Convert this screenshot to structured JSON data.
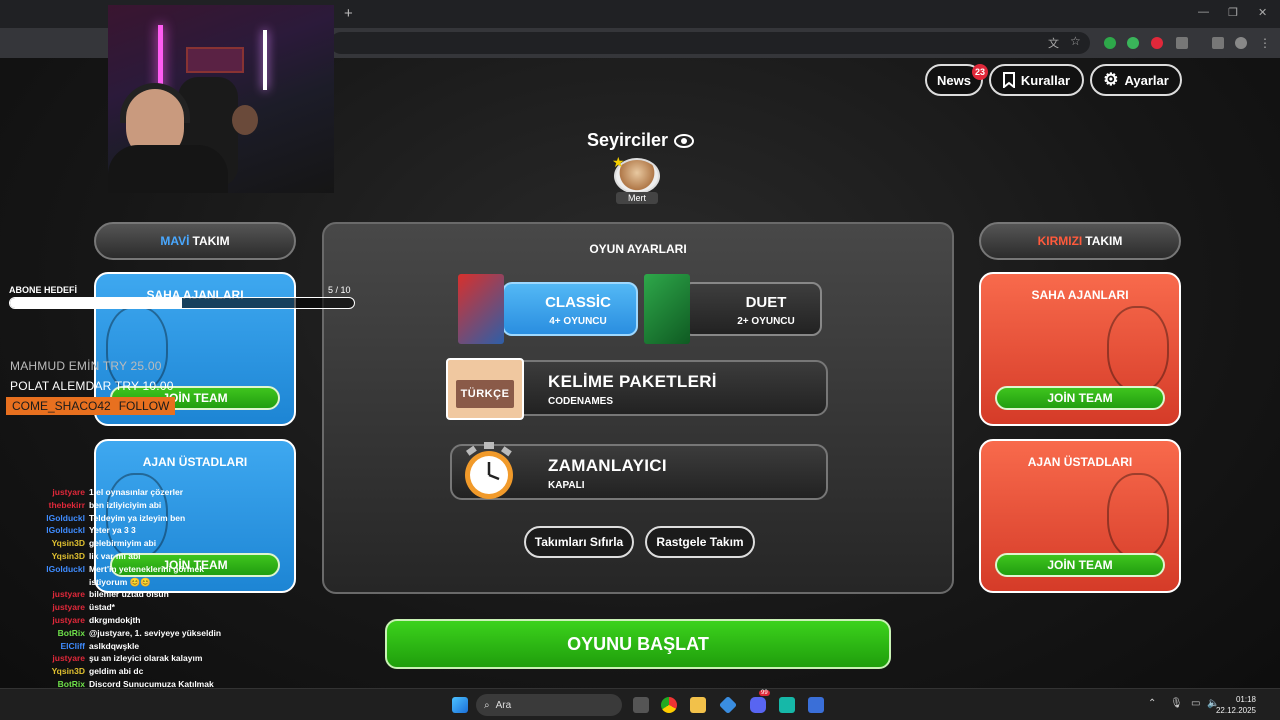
{
  "browser": {
    "new_tab_symbol": "+"
  },
  "header": {
    "news_label": "News",
    "news_badge": "23",
    "rules_label": "Kurallar",
    "settings_label": "Ayarlar"
  },
  "spectators": {
    "title": "Seyirciler",
    "user": "Mert"
  },
  "blue_team": {
    "title_color_word": "MAVİ",
    "title_word": "TAKIM",
    "operatives_title": "SAHA AJANLARI",
    "spymasters_title": "AJAN ÜSTADLARI",
    "join_label": "JOİN TEAM"
  },
  "red_team": {
    "title_color_word": "KIRMIZI",
    "title_word": "TAKIM",
    "operatives_title": "SAHA AJANLARI",
    "spymasters_title": "AJAN ÜSTADLARI",
    "join_label": "JOİN TEAM"
  },
  "game_settings": {
    "title": "OYUN AYARLARI",
    "modes": [
      {
        "name": "CLASSİC",
        "sub": "4+ OYUNCU",
        "selected": true
      },
      {
        "name": "DUET",
        "sub": "2+ OYUNCU",
        "selected": false
      }
    ],
    "word_packs": {
      "title": "KELİME PAKETLERİ",
      "sub": "CODENAMES",
      "tag": "TÜRKÇE"
    },
    "timer": {
      "title": "ZAMANLAYICI",
      "sub": "KAPALI"
    },
    "reset_teams_label": "Takımları Sıfırla",
    "random_team_label": "Rastgele Takım"
  },
  "start_label": "OYUNU BAŞLAT",
  "stream_overlay": {
    "goal_label": "ABONE HEDEFİ",
    "goal_count": "5 / 10",
    "goal_progress": 0.5,
    "donors": [
      "MAHMUD EMİN TRY 25.00",
      "POLAT ALEMDAR  TRY 10.00"
    ],
    "follow_name": "COME_SHACO42",
    "follow_label": "FOLLOW",
    "chat": [
      {
        "user": "justyare",
        "msg": "1 el oynasınlar çözerler",
        "color": "#e0283a"
      },
      {
        "user": "thebekirr",
        "msg": "ben izliyiciyim abi",
        "color": "#e0283a"
      },
      {
        "user": "lGolduckl",
        "msg": "Teldeyim ya izleyim ben",
        "color": "#3f8cff"
      },
      {
        "user": "lGolduckl",
        "msg": "Yeter ya 3 3",
        "color": "#3f8cff"
      },
      {
        "user": "Yqsin3D",
        "msg": "gelebirmiyim abi",
        "color": "#e0c030"
      },
      {
        "user": "Yqsin3D",
        "msg": "lik var mı abi",
        "color": "#e0c030"
      },
      {
        "user": "lGolduckl",
        "msg": "Mert'in yeteneklerini görmek istiyorum 😊😊",
        "color": "#3f8cff"
      },
      {
        "user": "justyare",
        "msg": "bilenler üztad olsun",
        "color": "#e0283a"
      },
      {
        "user": "justyare",
        "msg": "üstad*",
        "color": "#e0283a"
      },
      {
        "user": "justyare",
        "msg": "dkrgmdokjth",
        "color": "#e0283a"
      },
      {
        "user": "BotRix",
        "msg": "@justyare, 1. seviyeye yükseldin",
        "color": "#6ee04a"
      },
      {
        "user": "ElCliff",
        "msg": "aslkdqwşkle",
        "color": "#3f8cff"
      },
      {
        "user": "justyare",
        "msg": "şu an izleyici olarak kalayım",
        "color": "#e0283a"
      },
      {
        "user": "Yqsin3D",
        "msg": "geldim abi dc",
        "color": "#e0c030"
      },
      {
        "user": "BotRix",
        "msg": "Discord Sunucumuza Katılmak için; discord.gg/mertfatihyigit",
        "color": "#6ee04a"
      }
    ]
  },
  "taskbar": {
    "search_label": "Ara",
    "time": "01:18",
    "date": "22.12.2025",
    "discord_badge": "99"
  }
}
